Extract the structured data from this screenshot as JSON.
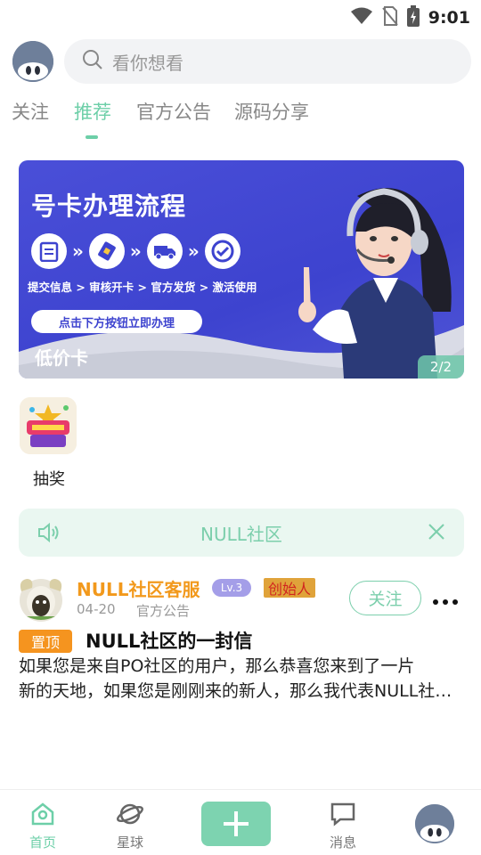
{
  "status_bar": {
    "time": "9:01"
  },
  "search": {
    "placeholder": "看你想看"
  },
  "tabs": [
    {
      "label": "关注",
      "active": false
    },
    {
      "label": "推荐",
      "active": true
    },
    {
      "label": "官方公告",
      "active": false
    },
    {
      "label": "源码分享",
      "active": false
    }
  ],
  "banner": {
    "title": "号卡办理流程",
    "steps_caption": "提交信息 > 审核开卡 > 官方发货 > 激活使用",
    "cta": "点击下方按钮立即办理",
    "label": "低价卡",
    "page_indicator": "2/2"
  },
  "quick_entries": [
    {
      "label": "抽奖",
      "icon": "lottery-icon"
    }
  ],
  "notice": {
    "text": "NULL社区",
    "icon": "speaker-icon"
  },
  "post": {
    "author": "NULL社区客服",
    "level": "Lv.3",
    "role_badge": "创始人",
    "date": "04-20",
    "category": "官方公告",
    "follow_label": "关注",
    "pin_label": "置顶",
    "title": "NULL社区的一封信",
    "body_line1": "如果您是来自PO社区的用户，那么恭喜您来到了一片",
    "body_line2": "新的天地，如果您是刚刚来的新人，那么我代表NULL社区欢迎您的到来"
  },
  "bottom_nav": {
    "home": "首页",
    "planet": "星球",
    "messages": "消息"
  },
  "colors": {
    "accent": "#6dcfa8",
    "banner_blue": "#3d43cf",
    "author_orange": "#f2991c",
    "pin_orange": "#f5941f"
  }
}
